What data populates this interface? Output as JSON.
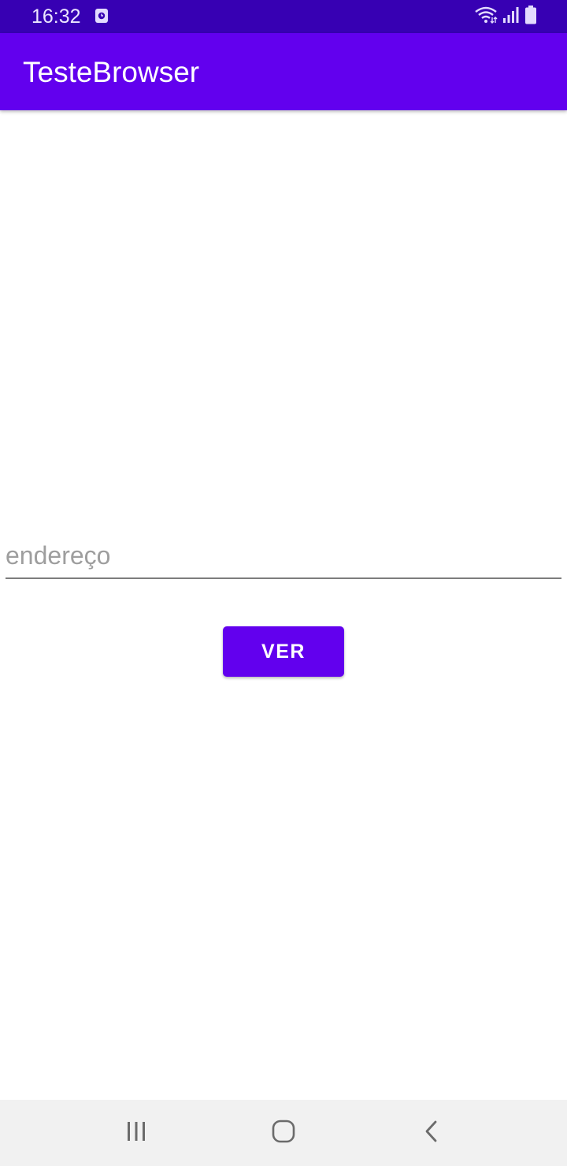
{
  "status_bar": {
    "time": "16:32",
    "icons": [
      "notification-calendar-icon",
      "wifi-icon",
      "signal-icon",
      "battery-icon"
    ],
    "background": "#3700b3"
  },
  "app_bar": {
    "title": "TesteBrowser",
    "background": "#6200ee"
  },
  "form": {
    "address_input": {
      "value": "",
      "placeholder": "endereço"
    },
    "submit_button": {
      "label": "VER",
      "color": "#6200ee"
    }
  },
  "nav_bar": {
    "buttons": [
      "recent-apps-icon",
      "home-icon",
      "back-icon"
    ]
  }
}
